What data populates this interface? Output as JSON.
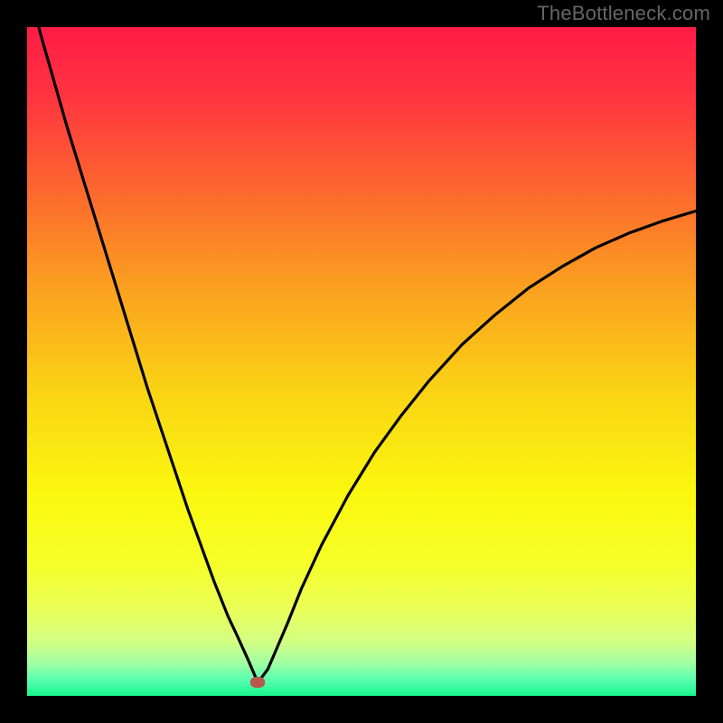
{
  "watermark": "TheBottleneck.com",
  "chart_data": {
    "type": "line",
    "title": "",
    "xlabel": "",
    "ylabel": "",
    "xlim": [
      0,
      100
    ],
    "ylim": [
      0,
      100
    ],
    "grid": false,
    "legend": null,
    "marker": {
      "x": 34.5,
      "y": 2.0
    },
    "series": [
      {
        "name": "curve",
        "x": [
          0,
          2,
          4,
          6,
          8,
          10,
          12,
          14,
          16,
          18,
          20,
          22,
          24,
          26,
          28,
          30,
          31.5,
          33,
          34.5,
          36,
          37.5,
          39,
          41,
          44,
          48,
          52,
          56,
          60,
          65,
          70,
          75,
          80,
          85,
          90,
          95,
          100
        ],
        "y": [
          107,
          99.0,
          92.0,
          85.0,
          78.5,
          72.0,
          65.5,
          59.0,
          52.5,
          46.0,
          40.0,
          34.0,
          28.0,
          22.5,
          17.0,
          12.0,
          8.8,
          5.5,
          2.0,
          4.0,
          7.5,
          11.0,
          16.0,
          22.5,
          30.0,
          36.5,
          42.0,
          47.0,
          52.5,
          57.0,
          61.0,
          64.2,
          67.0,
          69.2,
          71.0,
          72.5
        ]
      }
    ],
    "gradient_stops": [
      {
        "offset": 0.0,
        "color": "#ff1c46"
      },
      {
        "offset": 0.1,
        "color": "#ff3340"
      },
      {
        "offset": 0.25,
        "color": "#fc6a2d"
      },
      {
        "offset": 0.4,
        "color": "#fba41f"
      },
      {
        "offset": 0.55,
        "color": "#fad514"
      },
      {
        "offset": 0.7,
        "color": "#fbf80f"
      },
      {
        "offset": 0.8,
        "color": "#f6ff28"
      },
      {
        "offset": 0.87,
        "color": "#eaff58"
      },
      {
        "offset": 0.92,
        "color": "#d2ff84"
      },
      {
        "offset": 0.95,
        "color": "#a3ffa2"
      },
      {
        "offset": 0.975,
        "color": "#5cffb0"
      },
      {
        "offset": 1.0,
        "color": "#18f58d"
      }
    ]
  }
}
